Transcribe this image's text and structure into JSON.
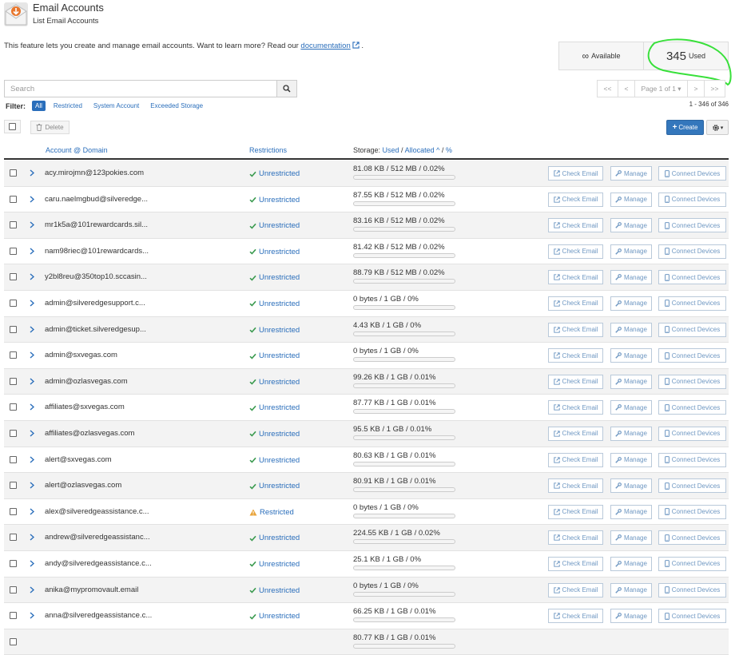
{
  "header": {
    "title": "Email Accounts",
    "subtitle": "List Email Accounts"
  },
  "intro": {
    "text": "This feature lets you create and manage email accounts. Want to learn more? Read our ",
    "link_text": "documentation",
    "suffix": "."
  },
  "stats": {
    "available_value": "∞",
    "available_label": "Available",
    "used_value": "345",
    "used_label": "Used"
  },
  "search": {
    "placeholder": "Search"
  },
  "pagination": {
    "first": "<<",
    "prev": "<",
    "page_label": "Page 1 of 1",
    "next": ">",
    "last": ">>",
    "range": "1 - 346 of 346"
  },
  "filter": {
    "label": "Filter:",
    "options": [
      "All",
      "Restricted",
      "System Account",
      "Exceeded Storage"
    ]
  },
  "toolbar": {
    "delete_label": "Delete",
    "create_label": "Create"
  },
  "table": {
    "header_account": "Account @ Domain",
    "header_restrictions": "Restrictions",
    "header_storage_prefix": "Storage: ",
    "header_used": "Used",
    "header_sep1": " / ",
    "header_allocated": "Allocated",
    "header_sep2": " / ",
    "header_percent": "%",
    "btn_check": "Check Email",
    "btn_manage": "Manage",
    "btn_connect": "Connect Devices",
    "rows": [
      {
        "account": "acy.mirojmn@123pokies.com",
        "restriction": "Unrestricted",
        "usage": "81.08 KB / 512 MB / 0.02%",
        "pct": 0.02
      },
      {
        "account": "caru.naelmgbud@silveredge...",
        "restriction": "Unrestricted",
        "usage": "87.55 KB / 512 MB / 0.02%",
        "pct": 0.02
      },
      {
        "account": "mr1k5a@101rewardcards.sil...",
        "restriction": "Unrestricted",
        "usage": "83.16 KB / 512 MB / 0.02%",
        "pct": 0.02
      },
      {
        "account": "nam98riec@101rewardcards...",
        "restriction": "Unrestricted",
        "usage": "81.42 KB / 512 MB / 0.02%",
        "pct": 0.02
      },
      {
        "account": "y2bl8reu@350top10.sccasin...",
        "restriction": "Unrestricted",
        "usage": "88.79 KB / 512 MB / 0.02%",
        "pct": 0.02
      },
      {
        "account": "admin@silveredgesupport.c...",
        "restriction": "Unrestricted",
        "usage": "0 bytes / 1 GB / 0%",
        "pct": 0
      },
      {
        "account": "admin@ticket.silveredgesup...",
        "restriction": "Unrestricted",
        "usage": "4.43 KB / 1 GB / 0%",
        "pct": 0
      },
      {
        "account": "admin@sxvegas.com",
        "restriction": "Unrestricted",
        "usage": "0 bytes / 1 GB / 0%",
        "pct": 0
      },
      {
        "account": "admin@ozlasvegas.com",
        "restriction": "Unrestricted",
        "usage": "99.26 KB / 1 GB / 0.01%",
        "pct": 0.01
      },
      {
        "account": "affiliates@sxvegas.com",
        "restriction": "Unrestricted",
        "usage": "87.77 KB / 1 GB / 0.01%",
        "pct": 0.01
      },
      {
        "account": "affiliates@ozlasvegas.com",
        "restriction": "Unrestricted",
        "usage": "95.5 KB / 1 GB / 0.01%",
        "pct": 0.01
      },
      {
        "account": "alert@sxvegas.com",
        "restriction": "Unrestricted",
        "usage": "80.63 KB / 1 GB / 0.01%",
        "pct": 0.01
      },
      {
        "account": "alert@ozlasvegas.com",
        "restriction": "Unrestricted",
        "usage": "80.91 KB / 1 GB / 0.01%",
        "pct": 0.01
      },
      {
        "account": "alex@silveredgeassistance.c...",
        "restriction": "Restricted",
        "usage": "0 bytes / 1 GB / 0%",
        "pct": 0
      },
      {
        "account": "andrew@silveredgeassistanc...",
        "restriction": "Unrestricted",
        "usage": "224.55 KB / 1 GB / 0.02%",
        "pct": 0.02
      },
      {
        "account": "andy@silveredgeassistance.c...",
        "restriction": "Unrestricted",
        "usage": "25.1 KB / 1 GB / 0%",
        "pct": 0
      },
      {
        "account": "anika@mypromovault.email",
        "restriction": "Unrestricted",
        "usage": "0 bytes / 1 GB / 0%",
        "pct": 0
      },
      {
        "account": "anna@silveredgeassistance.c...",
        "restriction": "Unrestricted",
        "usage": "66.25 KB / 1 GB / 0.01%",
        "pct": 0.01
      },
      {
        "account": "",
        "restriction": "",
        "usage": "80.77 KB / 1 GB / 0.01%",
        "pct": 0.01
      }
    ]
  },
  "colors": {
    "link": "#2a6ebb",
    "primary": "#3477bc",
    "success": "#3a9a4f",
    "warning": "#e8a33a",
    "annotation": "#38e03a"
  },
  "icons": {
    "app": "email-envelope-icon",
    "search": "search-icon",
    "delete": "trash-icon",
    "create": "plus-icon",
    "settings": "gear-icon",
    "row_expand": "chevron-right-icon",
    "unrestricted": "check-icon",
    "restricted": "warning-icon",
    "check_email": "external-link-icon",
    "manage": "wrench-icon",
    "connect": "mobile-icon"
  }
}
